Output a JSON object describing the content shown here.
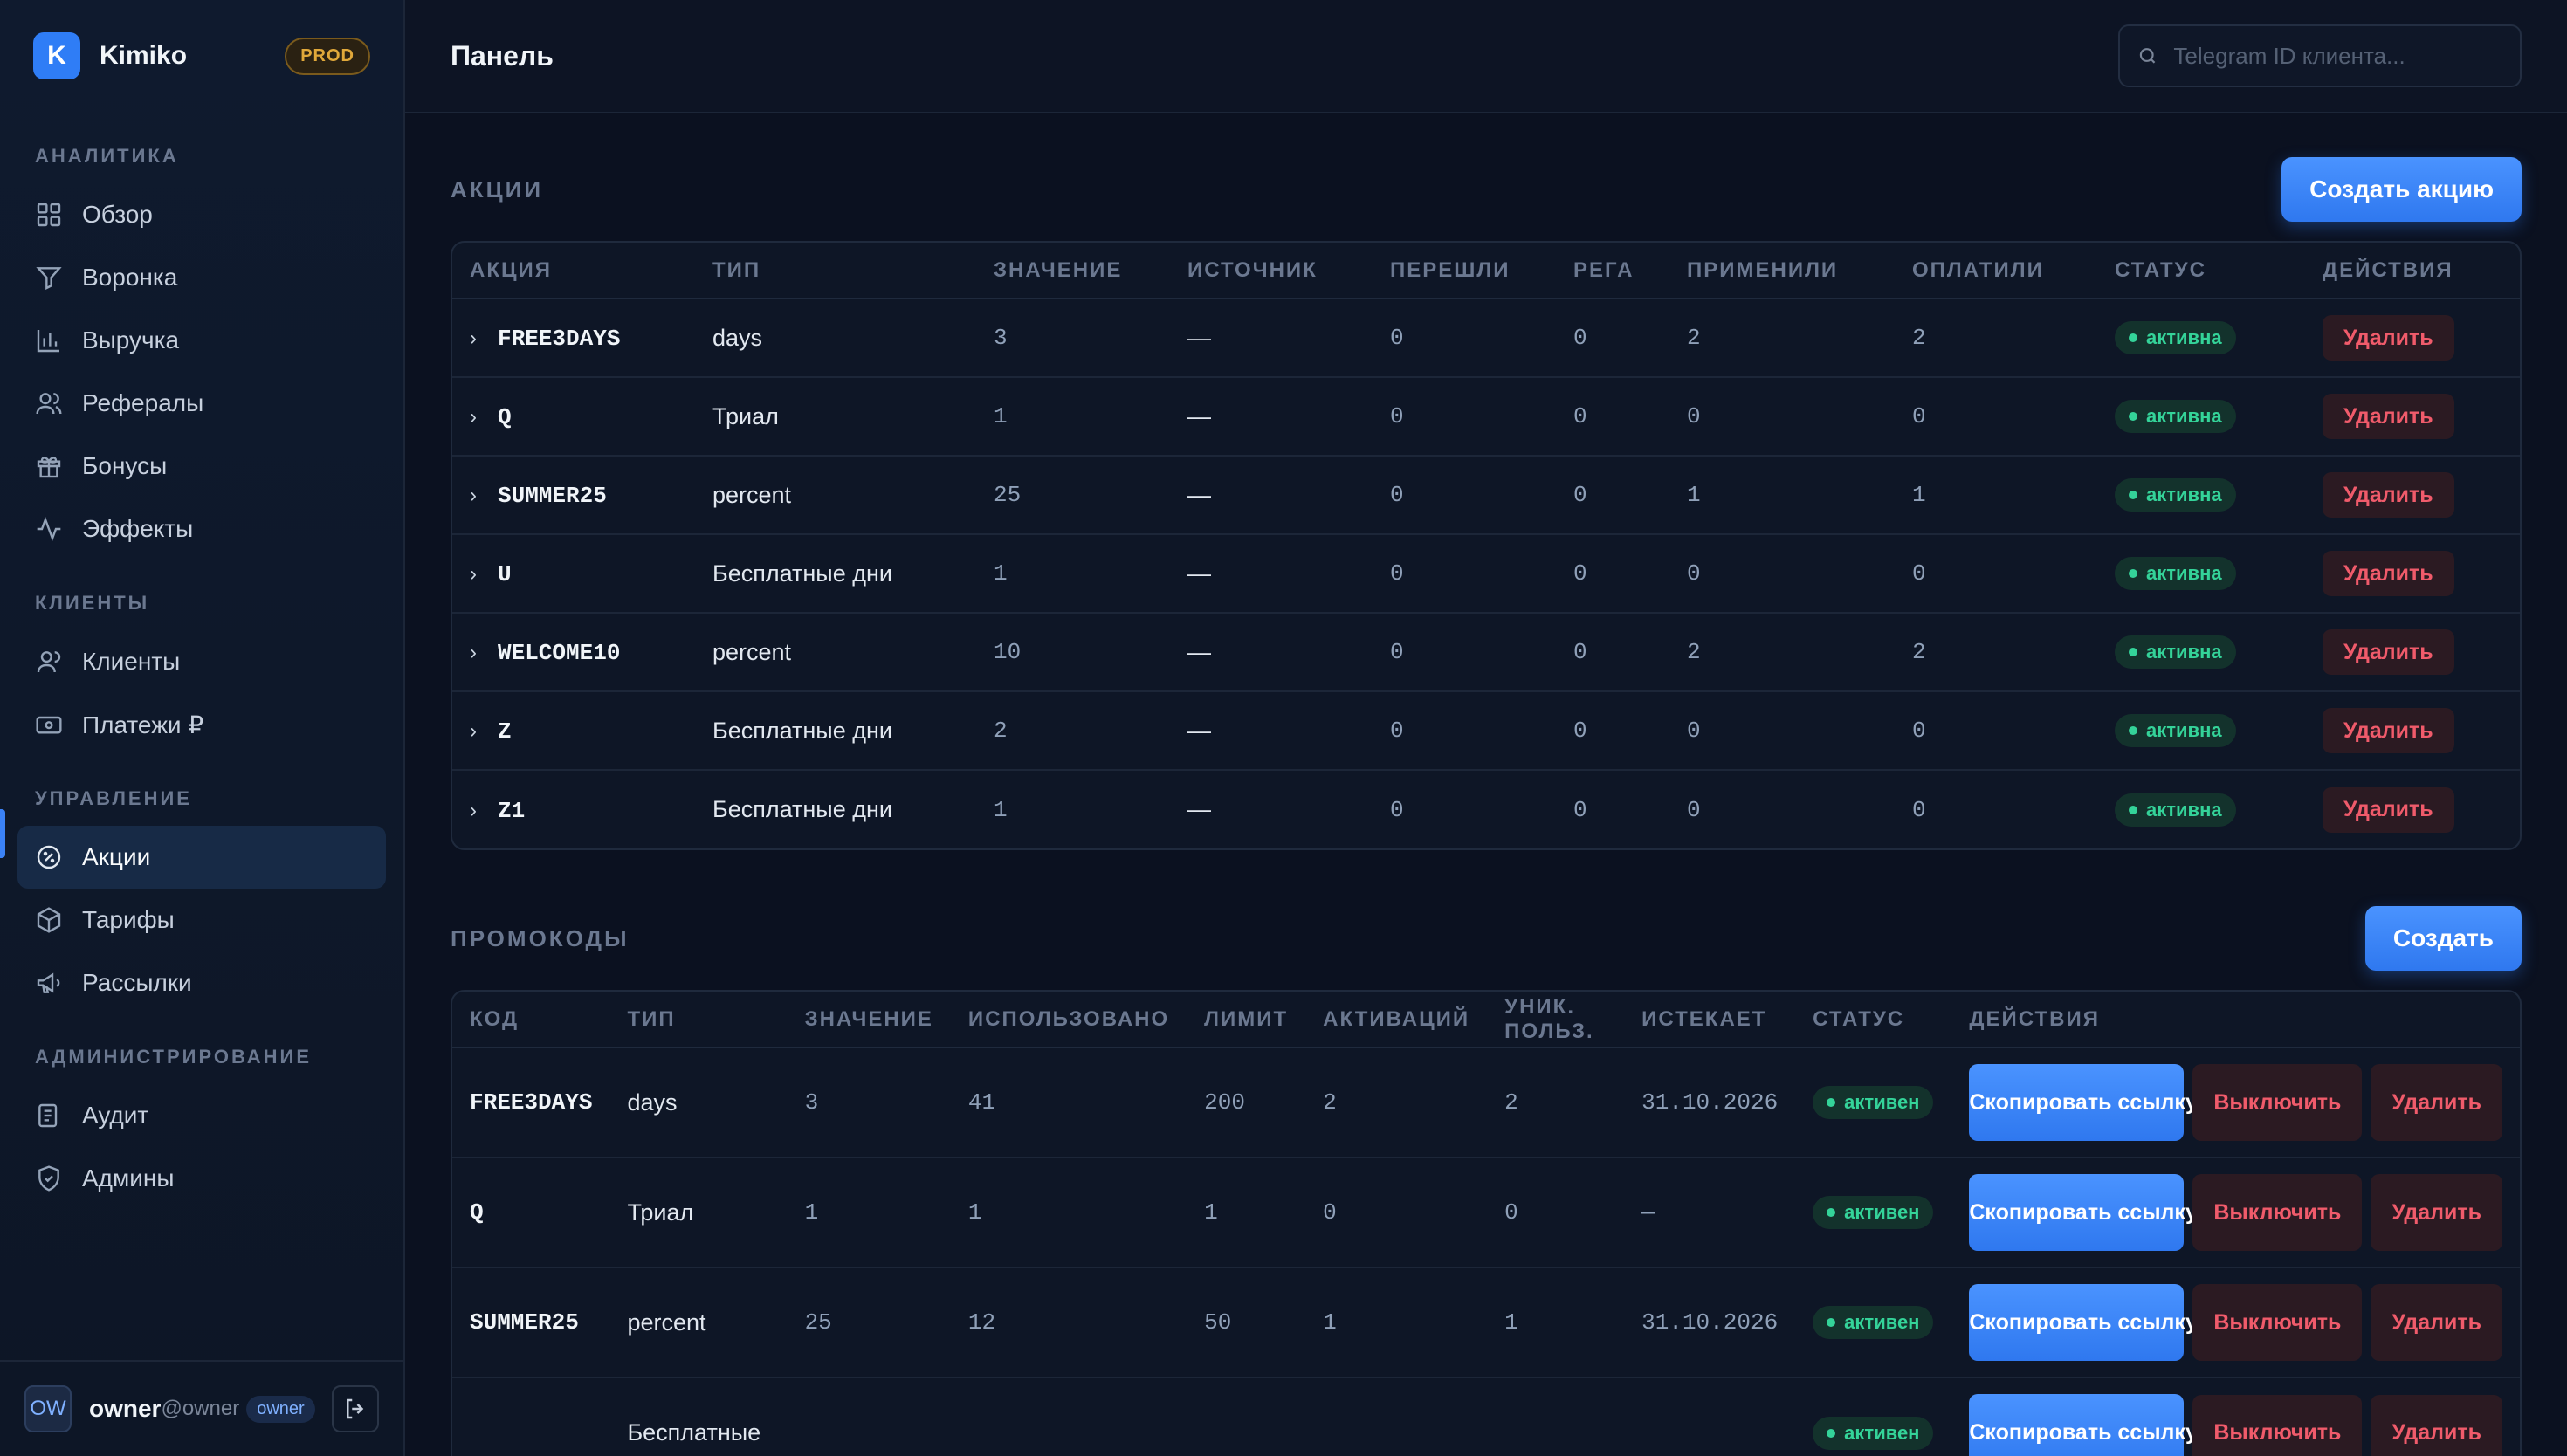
{
  "brand": {
    "logo_letter": "K",
    "name": "Kimiko",
    "env": "PROD"
  },
  "sidebar": {
    "sections": [
      {
        "title": "АНАЛИТИКА",
        "items": [
          {
            "label": "Обзор",
            "icon": "grid-icon"
          },
          {
            "label": "Воронка",
            "icon": "funnel-icon"
          },
          {
            "label": "Выручка",
            "icon": "bar-chart-icon"
          },
          {
            "label": "Рефералы",
            "icon": "users-icon"
          },
          {
            "label": "Бонусы",
            "icon": "gift-icon"
          },
          {
            "label": "Эффекты",
            "icon": "activity-icon"
          }
        ]
      },
      {
        "title": "КЛИЕНТЫ",
        "items": [
          {
            "label": "Клиенты",
            "icon": "user-icon"
          },
          {
            "label": "Платежи ₽",
            "icon": "wallet-icon"
          }
        ]
      },
      {
        "title": "УПРАВЛЕНИЕ",
        "items": [
          {
            "label": "Акции",
            "icon": "percent-badge-icon",
            "active": true
          },
          {
            "label": "Тарифы",
            "icon": "package-icon"
          },
          {
            "label": "Рассылки",
            "icon": "megaphone-icon"
          }
        ]
      },
      {
        "title": "АДМИНИСТРИРОВАНИЕ",
        "items": [
          {
            "label": "Аудит",
            "icon": "list-icon"
          },
          {
            "label": "Админы",
            "icon": "shield-icon"
          }
        ]
      }
    ]
  },
  "user": {
    "initials": "OW",
    "name": "owner",
    "handle": "@owner",
    "role": "owner"
  },
  "header": {
    "title": "Панель",
    "search_placeholder": "Telegram ID клиента..."
  },
  "actions_section": {
    "title": "АКЦИИ",
    "create_label": "Создать акцию",
    "columns": [
      "АКЦИЯ",
      "ТИП",
      "ЗНАЧЕНИЕ",
      "ИСТОЧНИК",
      "ПЕРЕШЛИ",
      "РЕГА",
      "ПРИМЕНИЛИ",
      "ОПЛАТИЛИ",
      "СТАТУС",
      "ДЕЙСТВИЯ"
    ],
    "rows": [
      {
        "code": "FREE3DAYS",
        "type": "days",
        "value": "3",
        "source": "—",
        "clicked": "0",
        "reg": "0",
        "applied": "2",
        "paid": "2",
        "status": "активна",
        "action": "Удалить"
      },
      {
        "code": "Q",
        "type": "Триал",
        "value": "1",
        "source": "—",
        "clicked": "0",
        "reg": "0",
        "applied": "0",
        "paid": "0",
        "status": "активна",
        "action": "Удалить"
      },
      {
        "code": "SUMMER25",
        "type": "percent",
        "value": "25",
        "source": "—",
        "clicked": "0",
        "reg": "0",
        "applied": "1",
        "paid": "1",
        "status": "активна",
        "action": "Удалить"
      },
      {
        "code": "U",
        "type": "Бесплатные дни",
        "value": "1",
        "source": "—",
        "clicked": "0",
        "reg": "0",
        "applied": "0",
        "paid": "0",
        "status": "активна",
        "action": "Удалить"
      },
      {
        "code": "WELCOME10",
        "type": "percent",
        "value": "10",
        "source": "—",
        "clicked": "0",
        "reg": "0",
        "applied": "2",
        "paid": "2",
        "status": "активна",
        "action": "Удалить"
      },
      {
        "code": "Z",
        "type": "Бесплатные дни",
        "value": "2",
        "source": "—",
        "clicked": "0",
        "reg": "0",
        "applied": "0",
        "paid": "0",
        "status": "активна",
        "action": "Удалить"
      },
      {
        "code": "Z1",
        "type": "Бесплатные дни",
        "value": "1",
        "source": "—",
        "clicked": "0",
        "reg": "0",
        "applied": "0",
        "paid": "0",
        "status": "активна",
        "action": "Удалить"
      }
    ]
  },
  "promo_section": {
    "title": "ПРОМОКОДЫ",
    "create_label": "Создать",
    "columns": [
      "КОД",
      "ТИП",
      "ЗНАЧЕНИЕ",
      "ИСПОЛЬЗОВАНО",
      "ЛИМИТ",
      "АКТИВАЦИЙ",
      "УНИК. ПОЛЬЗ.",
      "ИСТЕКАЕТ",
      "СТАТУС",
      "ДЕЙСТВИЯ"
    ],
    "copy_label": "Скопировать ссылку",
    "disable_label": "Выключить",
    "delete_label": "Удалить",
    "rows": [
      {
        "code": "FREE3DAYS",
        "type": "days",
        "value": "3",
        "used": "41",
        "limit": "200",
        "activations": "2",
        "unique": "2",
        "expires": "31.10.2026",
        "status": "активен"
      },
      {
        "code": "Q",
        "type": "Триал",
        "value": "1",
        "used": "1",
        "limit": "1",
        "activations": "0",
        "unique": "0",
        "expires": "—",
        "status": "активен"
      },
      {
        "code": "SUMMER25",
        "type": "percent",
        "value": "25",
        "used": "12",
        "limit": "50",
        "activations": "1",
        "unique": "1",
        "expires": "31.10.2026",
        "status": "активен"
      },
      {
        "code": "",
        "type": "Бесплатные",
        "value": "",
        "used": "",
        "limit": "",
        "activations": "",
        "unique": "",
        "expires": "",
        "status": "активен"
      }
    ]
  },
  "colors": {
    "accent": "#2f7df6",
    "success": "#34d399",
    "danger": "#f05b6b",
    "warning": "#e0a83a",
    "background": "#0b1120"
  }
}
